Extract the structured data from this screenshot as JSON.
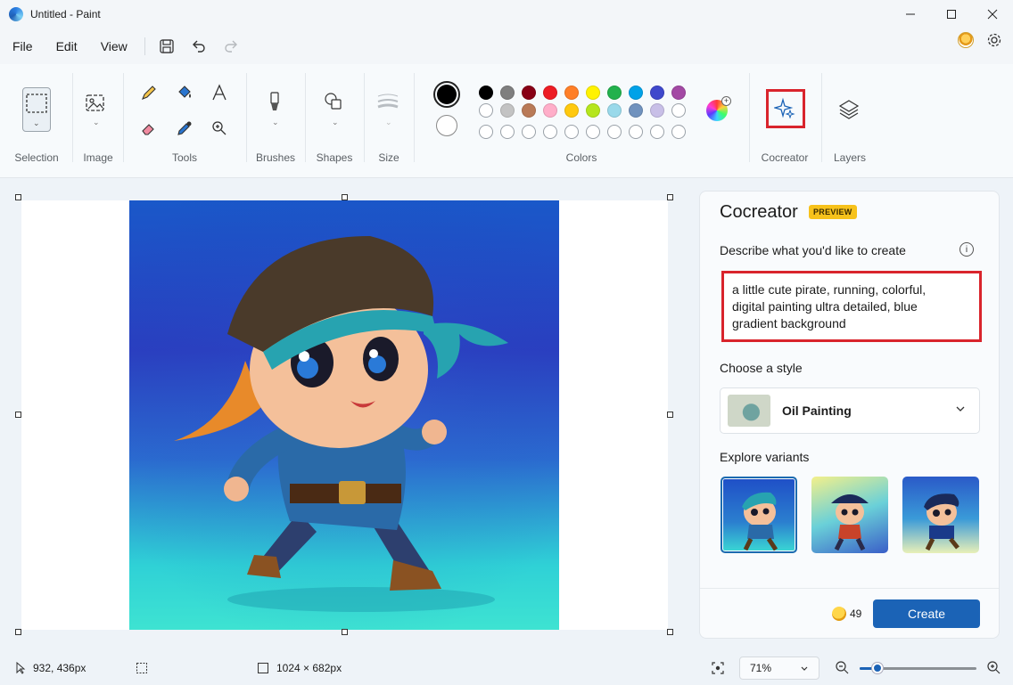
{
  "window": {
    "title": "Untitled - Paint"
  },
  "menu": {
    "file": "File",
    "edit": "Edit",
    "view": "View"
  },
  "ribbon": {
    "selection": "Selection",
    "image": "Image",
    "tools": "Tools",
    "brushes": "Brushes",
    "shapes": "Shapes",
    "size": "Size",
    "colors": "Colors",
    "cocreator": "Cocreator",
    "layers": "Layers",
    "primary_color": "#000000",
    "secondary_color": "#ffffff",
    "palette_row1": [
      "#000000",
      "#7f7f7f",
      "#880015",
      "#ed1c24",
      "#ff7f27",
      "#fff200",
      "#22b14c",
      "#00a2e8",
      "#3f48cc",
      "#a349a4"
    ],
    "palette_row2": [
      "#ffffff",
      "#c3c3c3",
      "#b97a57",
      "#ffaec9",
      "#ffc90e",
      "#b5e61d",
      "#99d9ea",
      "#7092be",
      "#c8bfe7"
    ]
  },
  "cocreator_panel": {
    "title": "Cocreator",
    "badge": "PREVIEW",
    "describe_label": "Describe what you'd like to create",
    "prompt_line1": "a little cute pirate, running, colorful,",
    "prompt_line2": "digital painting ultra detailed, blue",
    "prompt_line3": "gradient background",
    "style_label": "Choose a style",
    "style_value": "Oil Painting",
    "variants_label": "Explore variants",
    "credits": "49",
    "create_button": "Create"
  },
  "status": {
    "cursor_position": "932, 436px",
    "canvas_size": "1024 × 682px",
    "zoom": "71%",
    "zoom_fraction": 0.15
  }
}
